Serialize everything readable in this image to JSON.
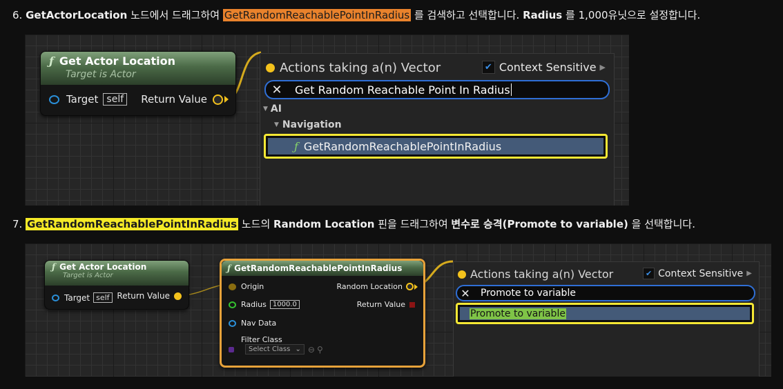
{
  "step6": {
    "num": "6.",
    "node_name": "GetActorLocation",
    "text_a": "노드에서 드래그하여",
    "highlight": "GetRandomReachablePointInRadius",
    "text_b": "를 검색하고 선택합니다.",
    "param": "Radius",
    "text_c": "를 1,000유닛으로 설정합니다."
  },
  "step7": {
    "num": "7.",
    "highlight": "GetRandomReachablePointInRadius",
    "text_a": "노드의",
    "pin_name": "Random Location",
    "text_b": "핀을 드래그하여",
    "action": "변수로 승격(Promote to variable)",
    "text_c": "을 선택합니다."
  },
  "panel1": {
    "node": {
      "icon": "ƒ",
      "title": "Get Actor Location",
      "subtitle": "Target is Actor",
      "target_label": "Target",
      "target_value": "self",
      "return_label": "Return Value"
    },
    "menu": {
      "title": "Actions taking a(n) Vector",
      "context_label": "Context Sensitive",
      "context_checked": true,
      "search_value": "Get Random Reachable Point In Radius",
      "category_ai": "AI",
      "category_navigation": "Navigation",
      "result_icon": "ƒ",
      "result_label": "GetRandomReachablePointInRadius"
    }
  },
  "panel2": {
    "node_a": {
      "icon": "ƒ",
      "title": "Get Actor Location",
      "subtitle": "Target is Actor",
      "target_label": "Target",
      "target_value": "self",
      "return_label": "Return Value"
    },
    "node_b": {
      "icon": "ƒ",
      "title": "GetRandomReachablePointInRadius",
      "pin_origin": "Origin",
      "pin_radius": "Radius",
      "radius_value": "1000.0",
      "pin_nav_data": "Nav Data",
      "pin_filter_class": "Filter Class",
      "filter_select": "Select Class",
      "out_random_location": "Random Location",
      "out_return_value": "Return Value"
    },
    "menu": {
      "title": "Actions taking a(n) Vector",
      "context_label": "Context Sensitive",
      "context_checked": true,
      "search_value": "Promote to variable",
      "result_label": "Promote to variable"
    }
  },
  "colors": {
    "highlight_orange": "#e9822c",
    "highlight_yellow": "#f5ea27",
    "vector_pin": "#f4c21c",
    "object_pin": "#2a8fd8",
    "float_pin": "#34c230",
    "bool_pin": "#8b1414",
    "selection_border": "#f6e834",
    "search_border": "#2f6fd6"
  }
}
